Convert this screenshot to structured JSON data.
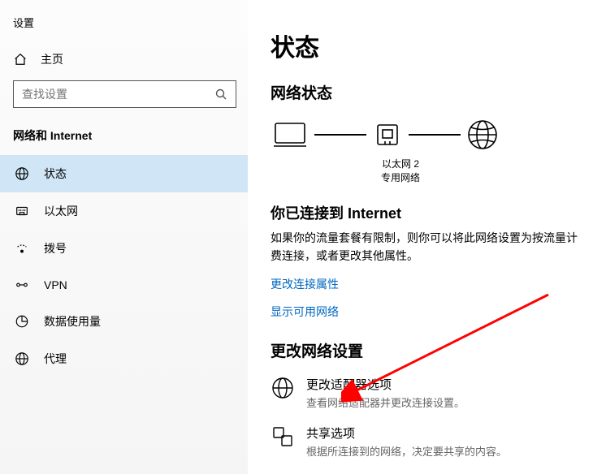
{
  "app_title": "设置",
  "home_label": "主页",
  "search_placeholder": "查找设置",
  "section_title": "网络和 Internet",
  "nav": [
    {
      "label": "状态"
    },
    {
      "label": "以太网"
    },
    {
      "label": "拨号"
    },
    {
      "label": "VPN"
    },
    {
      "label": "数据使用量"
    },
    {
      "label": "代理"
    }
  ],
  "page_title": "状态",
  "network_status_title": "网络状态",
  "diagram": {
    "label1": "以太网 2",
    "label2": "专用网络"
  },
  "connected_title": "你已连接到 Internet",
  "connected_desc": "如果你的流量套餐有限制，则你可以将此网络设置为按流量计费连接，或者更改其他属性。",
  "link_change_conn": "更改连接属性",
  "link_show_networks": "显示可用网络",
  "change_settings_title": "更改网络设置",
  "options": [
    {
      "title": "更改适配器选项",
      "desc": "查看网络适配器并更改连接设置。"
    },
    {
      "title": "共享选项",
      "desc": "根据所连接到的网络，决定要共享的内容。"
    }
  ]
}
